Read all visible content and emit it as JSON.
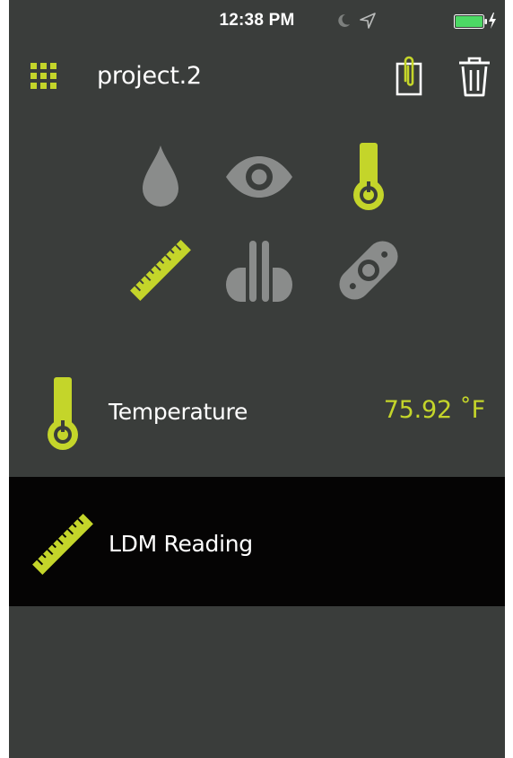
{
  "status_bar": {
    "time": "12:38 PM",
    "icons": [
      "moon-icon",
      "location-arrow-icon",
      "battery-icon",
      "charging-bolt-icon"
    ]
  },
  "header": {
    "title": "project.2",
    "left_icon": "grid-icon",
    "right_icons": [
      "clipboard-icon",
      "trash-icon"
    ]
  },
  "tools": [
    {
      "icon": "moisture-drop-icon",
      "active": false
    },
    {
      "icon": "infrared-eye-icon",
      "active": false
    },
    {
      "icon": "thermometer-icon",
      "active": true
    },
    {
      "icon": "ldm-ruler-icon",
      "active": true
    },
    {
      "icon": "pin-probe-icon",
      "active": false
    },
    {
      "icon": "pinless-pad-icon",
      "active": false
    }
  ],
  "readings": [
    {
      "icon": "thermometer-icon",
      "label": "Temperature",
      "value": "75.92 ˚F",
      "selected": false
    },
    {
      "icon": "ldm-ruler-icon",
      "label": "LDM Reading",
      "value": "",
      "selected": true
    }
  ],
  "colors": {
    "background": "#3a3d3b",
    "accent": "#c4d52a",
    "inactive_icon": "#8a8c8b",
    "selected_row": "#050404",
    "text": "#ffffff"
  }
}
